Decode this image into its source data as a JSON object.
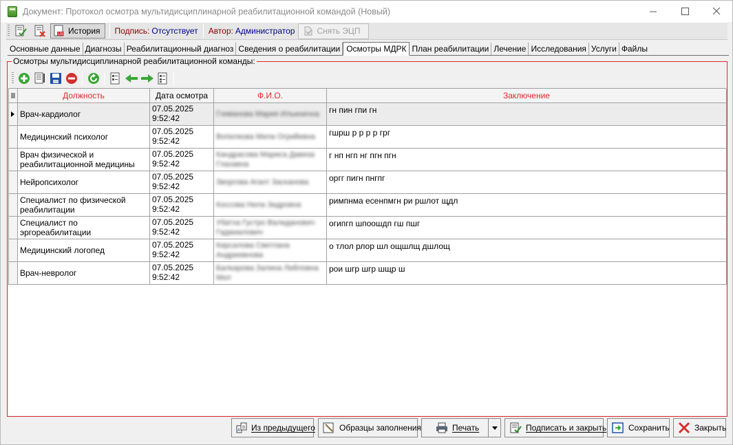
{
  "window": {
    "title": "Документ: Протокол осмотра мультидисциплинарной реабилитационной командой (Новый)"
  },
  "toolbar": {
    "history_label": "История",
    "signature_label": "Подпись:",
    "signature_value": "Отсутствует",
    "author_label": "Автор:",
    "author_value": "Администратор",
    "remove_ecp_label": "Снять ЭЦП"
  },
  "tabs": [
    {
      "label": "Основные данные",
      "active": false
    },
    {
      "label": "Диагнозы",
      "active": false
    },
    {
      "label": "Реабилитационный диагноз",
      "active": false
    },
    {
      "label": "Сведения о реабилитации",
      "active": false
    },
    {
      "label": "Осмотры МДРК",
      "active": true
    },
    {
      "label": "План реабилитации",
      "active": false
    },
    {
      "label": "Лечение",
      "active": false
    },
    {
      "label": "Исследования",
      "active": false
    },
    {
      "label": "Услуги",
      "active": false
    },
    {
      "label": "Файлы",
      "active": false
    }
  ],
  "group": {
    "caption": "Осмотры мультидисциплинарной реабилитационной команды:"
  },
  "grid": {
    "columns": {
      "position": "Должность",
      "date": "Дата осмотра",
      "fio": "Ф.И.О.",
      "conclusion": "Заключение"
    },
    "rows": [
      {
        "position": "Врач-кардиолог",
        "date": "07.05.2025",
        "time": "9:52:42",
        "fio": "Гливанова Мария Ильинична",
        "conclusion": "гн пин гпи гн",
        "selected": true
      },
      {
        "position": "Медицинский психолог",
        "date": "07.05.2025",
        "time": "9:52:42",
        "fio": "Вопилкова Мила Огрийевна",
        "conclusion": "гшрш р р р р грг",
        "selected": false
      },
      {
        "position": "Врач физической и реабилитационной медицины",
        "date": "07.05.2025",
        "time": "9:52:42",
        "fio": "Кандрасова Мариса Давиза Глахавна",
        "conclusion": "г нп нгп нг пгн пгн",
        "selected": false
      },
      {
        "position": "Нейропсихолог",
        "date": "07.05.2025",
        "time": "9:52:42",
        "fio": "Зворгова Агант Засканова",
        "conclusion": "оргг пигн пнгпг",
        "selected": false
      },
      {
        "position": "Специалист по физической реабилитации",
        "date": "07.05.2025",
        "time": "9:52:42",
        "fio": "Коссова Нила Зедровна",
        "conclusion": "римпнма есенпмгн ри ршлот щдл",
        "selected": false
      },
      {
        "position": "Специалист по эргореабилитации",
        "date": "07.05.2025",
        "time": "9:52:42",
        "fio": "Убатха Густро Валиданович Гаджиалович",
        "conclusion": "огипгп шпоошдп гш пшг",
        "selected": false
      },
      {
        "position": "Медицинский логопед",
        "date": "07.05.2025",
        "time": "9:52:42",
        "fio": "Кирсалова Светлана Андреевнова",
        "conclusion": "о тлол рлор шл ощшлщ дшлощ",
        "selected": false
      },
      {
        "position": "Врач-невролог",
        "date": "07.05.2025",
        "time": "9:52:42",
        "fio": "Балкарова Залина Лейловна Мол",
        "conclusion": "рои шгр шгр шщр ш",
        "selected": false
      }
    ]
  },
  "buttons": {
    "from_previous": "Из предыдущего",
    "templates": "Образцы заполнения",
    "print": "Печать",
    "sign_close": "Подписать и закрыть",
    "save": "Сохранить",
    "close": "Закрыть"
  },
  "colors": {
    "accent_red": "#e0292b",
    "green": "#3aa635",
    "selected_row": "#ececec"
  }
}
